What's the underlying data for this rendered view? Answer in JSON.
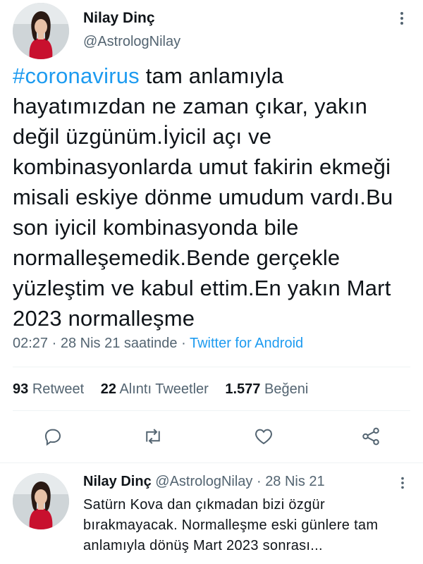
{
  "tweet": {
    "author": {
      "name": "Nilay Dinç",
      "handle": "@AstrologNilay"
    },
    "hashtag": "#coronavirus",
    "text": " tam anlamıyla hayatımızdan ne zaman çıkar, yakın değil üzgünüm.İyicil açı ve kombinasyonlarda umut fakirin ekmeği misali eskiye dönme umudum vardı.Bu son iyicil kombinasyonda bile normalleşemedik.Bende gerçekle yüzleştim ve kabul ettim.En yakın Mart 2023  normalleşme",
    "time": "02:27",
    "date": "28 Nis 21 saatinde",
    "separator": "·",
    "source": "Twitter for Android",
    "stats": {
      "retweets": "93",
      "retweets_label": "Retweet",
      "quotes": "22",
      "quotes_label": "Alıntı Tweetler",
      "likes": "1.577",
      "likes_label": "Beğeni"
    }
  },
  "actions": [
    "reply-icon",
    "retweet-icon",
    "like-icon",
    "share-icon"
  ],
  "reply": {
    "name": "Nilay Dinç",
    "handle": "@AstrologNilay",
    "separator": "·",
    "date": "28 Nis 21",
    "text": "Satürn Kova dan çıkmadan bizi özgür bırakmayacak. Normalleşme eski günlere tam anlamıyla dönüş Mart 2023 sonrası..."
  },
  "colors": {
    "accent": "#1d9bf0",
    "muted": "#536471",
    "text": "#0f1419",
    "divider": "#eff3f4"
  }
}
